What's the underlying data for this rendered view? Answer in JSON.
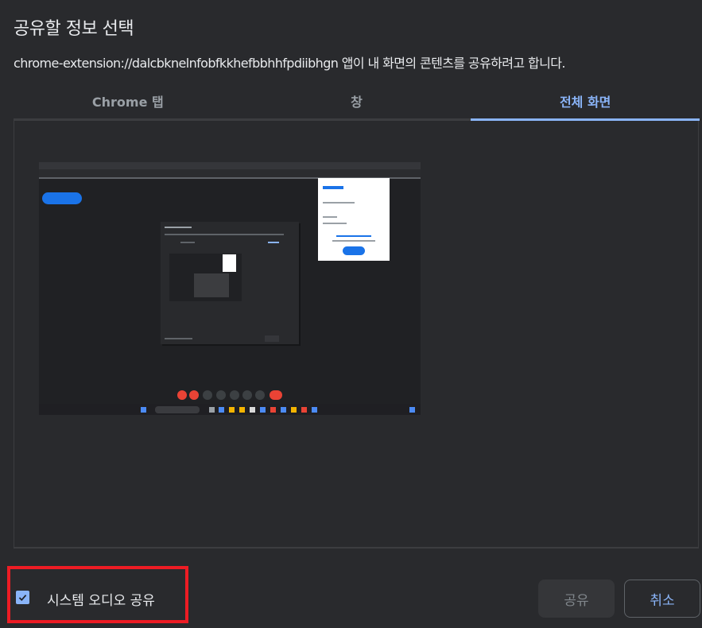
{
  "dialog": {
    "title": "공유할 정보 선택",
    "subtitle": "chrome-extension://dalcbknelnfobfkkhefbbhhfpdiibhgn 앱이 내 화면의 콘텐츠를 공유하려고 합니다."
  },
  "tabs": [
    {
      "label": "Chrome 탭",
      "active": false
    },
    {
      "label": "창",
      "active": false
    },
    {
      "label": "전체 화면",
      "active": true
    }
  ],
  "preview": {
    "item": "screen-thumbnail",
    "selected": false
  },
  "footer": {
    "audio_checkbox": {
      "label": "시스템 오디오 공유",
      "checked": true
    },
    "share_label": "공유",
    "share_enabled": false,
    "cancel_label": "취소"
  },
  "colors": {
    "accent": "#8ab4f8",
    "background": "#292a2d",
    "highlight_box": "#ed1c24"
  }
}
